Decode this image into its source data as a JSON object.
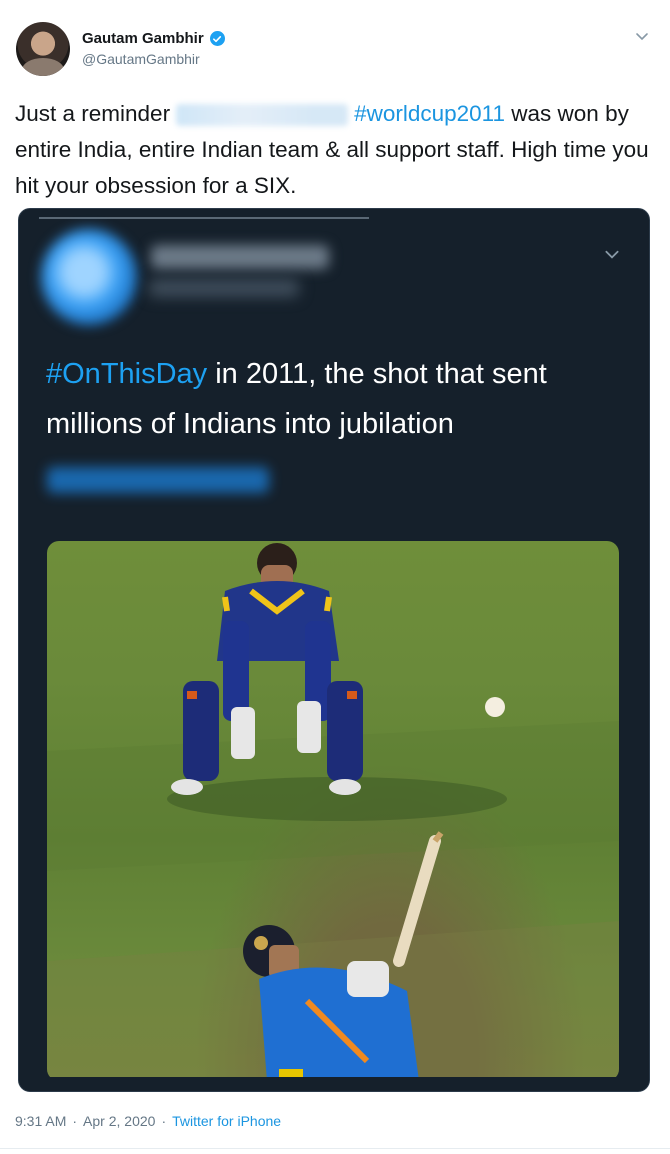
{
  "author": {
    "display_name": "Gautam Gambhir",
    "handle": "@GautamGambhir",
    "verified_icon": "verified-badge-icon"
  },
  "tweet": {
    "text_before": "Just a reminder",
    "hashtag": "#worldcup2011",
    "text_after": "was won by entire India, entire Indian team & all support staff. High time you hit your obsession for a SIX."
  },
  "quoted_tweet": {
    "hashtag": "#OnThisDay",
    "text": " in 2011, the shot that sent millions of Indians into jubilation"
  },
  "footer": {
    "time": "9:31 AM",
    "date": "Apr 2, 2020",
    "separator": "·",
    "source": "Twitter for iPhone"
  },
  "colors": {
    "link": "#1b95e0",
    "quote_background": "#15202b"
  }
}
